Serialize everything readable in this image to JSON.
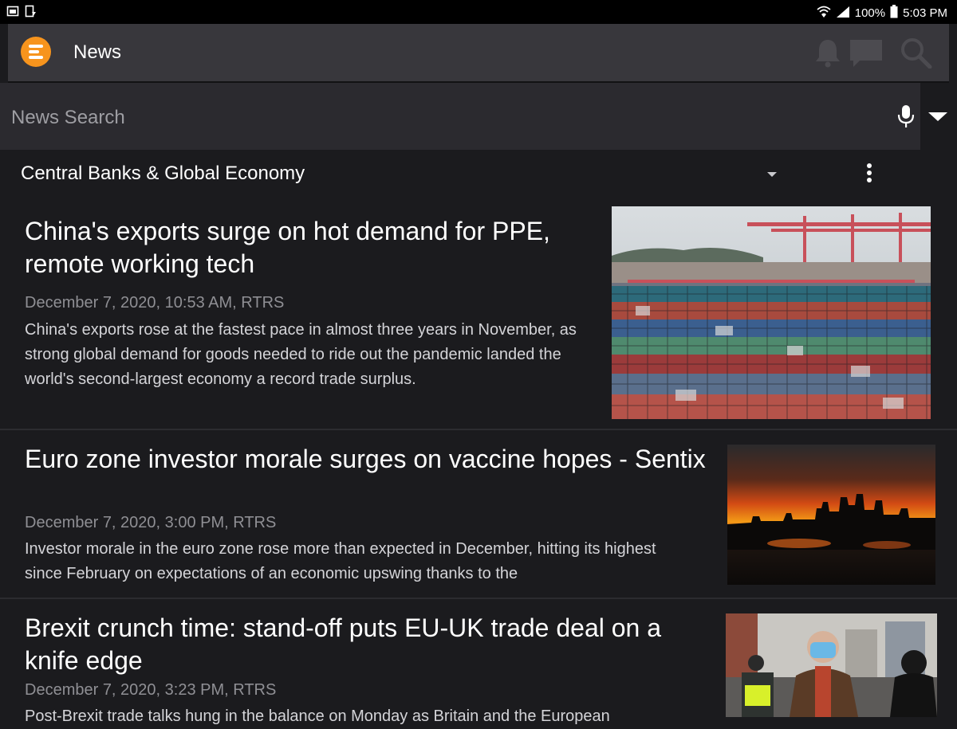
{
  "status_bar": {
    "battery": "100%",
    "time": "5:03 PM",
    "icons": [
      "gallery-icon",
      "download-icon",
      "wifi-icon",
      "signal-icon",
      "battery-icon"
    ]
  },
  "app_bar": {
    "title": "News",
    "logo": "app-logo",
    "actions": [
      "bell-icon",
      "chat-icon",
      "search-icon"
    ]
  },
  "search": {
    "placeholder": "News Search",
    "value": ""
  },
  "category": {
    "label": "Central Banks & Global Economy"
  },
  "colors": {
    "background": "#1b1b1e",
    "app_bar": "#38373c",
    "search_bar": "#2b2a2f",
    "logo": "#f7941d",
    "meta_text": "#8f8f94"
  },
  "articles": [
    {
      "title": "China's exports surge on hot demand for PPE, remote working tech",
      "meta": "December 7, 2020, 10:53 AM, RTRS",
      "summary": "China's exports rose at the fastest pace in almost three years in November, as strong global demand for goods needed to ride out the pandemic landed the world's second-largest economy a record trade surplus."
    },
    {
      "title": "Euro zone investor morale surges on vaccine hopes - Sentix",
      "meta": "December 7, 2020, 3:00 PM, RTRS",
      "summary": "Investor morale in the euro zone rose more than expected in December, hitting its highest since February on expectations of an economic upswing thanks to the"
    },
    {
      "title": "Brexit crunch time: stand-off puts EU-UK trade deal on a knife edge",
      "meta": "December 7, 2020, 3:23 PM, RTRS",
      "summary": "Post-Brexit trade talks hung in the balance on Monday as Britain and the European"
    }
  ]
}
